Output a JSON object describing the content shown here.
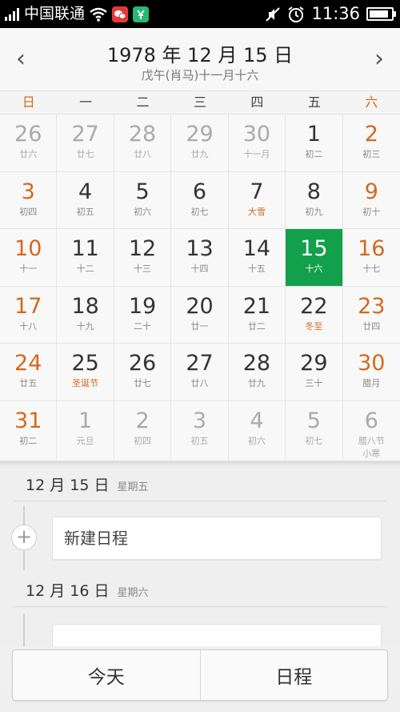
{
  "status_bar": {
    "carrier": "中国联通",
    "time": "11:36",
    "battery_level": 0.9,
    "icons": [
      "signal-icon",
      "wifi-icon",
      "chat-app-icon",
      "wallet-app-icon",
      "mute-icon",
      "alarm-icon",
      "battery-icon"
    ],
    "colors": {
      "chat_app": "#e23a3a",
      "wallet_app": "#2bb673"
    }
  },
  "header": {
    "title": "1978 年 12 月 15 日",
    "subtitle": "戊午(肖马)十一月十六",
    "prev_icon": "‹",
    "next_icon": "›"
  },
  "weekdays": [
    "日",
    "一",
    "二",
    "三",
    "四",
    "五",
    "六"
  ],
  "calendar": {
    "accent_color": "#12a04a",
    "weekend_color": "#d2691e",
    "weeks": [
      [
        {
          "day": "26",
          "lunar": "廿六",
          "other": true
        },
        {
          "day": "27",
          "lunar": "廿七",
          "other": true
        },
        {
          "day": "28",
          "lunar": "廿八",
          "other": true
        },
        {
          "day": "29",
          "lunar": "廿九",
          "other": true
        },
        {
          "day": "30",
          "lunar": "十一月",
          "other": true
        },
        {
          "day": "1",
          "lunar": "初二"
        },
        {
          "day": "2",
          "lunar": "初三"
        }
      ],
      [
        {
          "day": "3",
          "lunar": "初四"
        },
        {
          "day": "4",
          "lunar": "初五"
        },
        {
          "day": "5",
          "lunar": "初六"
        },
        {
          "day": "6",
          "lunar": "初七"
        },
        {
          "day": "7",
          "lunar": "大雪",
          "festival": true
        },
        {
          "day": "8",
          "lunar": "初九"
        },
        {
          "day": "9",
          "lunar": "初十"
        }
      ],
      [
        {
          "day": "10",
          "lunar": "十一"
        },
        {
          "day": "11",
          "lunar": "十二"
        },
        {
          "day": "12",
          "lunar": "十三"
        },
        {
          "day": "13",
          "lunar": "十四"
        },
        {
          "day": "14",
          "lunar": "十五"
        },
        {
          "day": "15",
          "lunar": "十六",
          "selected": true
        },
        {
          "day": "16",
          "lunar": "十七"
        }
      ],
      [
        {
          "day": "17",
          "lunar": "十八"
        },
        {
          "day": "18",
          "lunar": "十九"
        },
        {
          "day": "19",
          "lunar": "二十"
        },
        {
          "day": "20",
          "lunar": "廿一"
        },
        {
          "day": "21",
          "lunar": "廿二"
        },
        {
          "day": "22",
          "lunar": "冬至",
          "festival": true
        },
        {
          "day": "23",
          "lunar": "廿四"
        }
      ],
      [
        {
          "day": "24",
          "lunar": "廿五"
        },
        {
          "day": "25",
          "lunar": "圣诞节",
          "festival": true
        },
        {
          "day": "26",
          "lunar": "廿七"
        },
        {
          "day": "27",
          "lunar": "廿八"
        },
        {
          "day": "28",
          "lunar": "廿九"
        },
        {
          "day": "29",
          "lunar": "三十"
        },
        {
          "day": "30",
          "lunar": "腊月"
        }
      ],
      [
        {
          "day": "31",
          "lunar": "初二"
        },
        {
          "day": "1",
          "lunar": "元旦",
          "other": true
        },
        {
          "day": "2",
          "lunar": "初四",
          "other": true
        },
        {
          "day": "3",
          "lunar": "初五",
          "other": true
        },
        {
          "day": "4",
          "lunar": "初六",
          "other": true
        },
        {
          "day": "5",
          "lunar": "初七",
          "other": true
        },
        {
          "day": "6",
          "lunar": "腊八节",
          "lunar2": "小寒",
          "other": true
        }
      ]
    ]
  },
  "agenda": {
    "days": [
      {
        "date": "12 月 15 日",
        "weekday": "星期五",
        "add_icon": "+",
        "event": "新建日程"
      },
      {
        "date": "12 月 16 日",
        "weekday": "星期六",
        "event": ""
      }
    ]
  },
  "bottom_bar": {
    "today_label": "今天",
    "schedule_label": "日程"
  }
}
